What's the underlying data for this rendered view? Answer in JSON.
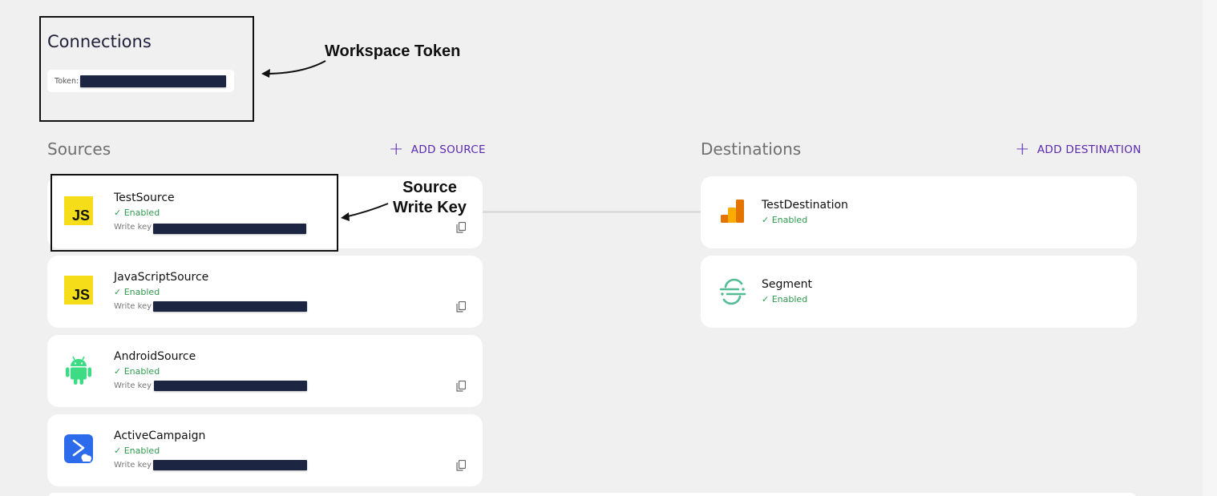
{
  "header": {
    "title": "Connections",
    "token_label": "Token:",
    "token_value": "(redacted)"
  },
  "annotations": {
    "workspace_token": "Workspace Token",
    "source_write_key_line1": "Source",
    "source_write_key_line2": "Write Key"
  },
  "sources": {
    "title": "Sources",
    "add_label": "ADD SOURCE",
    "items": [
      {
        "name": "TestSource",
        "status": "Enabled",
        "key_label": "Write key",
        "logo": "js-icon"
      },
      {
        "name": "JavaScriptSource",
        "status": "Enabled",
        "key_label": "Write key",
        "logo": "js-icon"
      },
      {
        "name": "AndroidSource",
        "status": "Enabled",
        "key_label": "Write key",
        "logo": "android-icon"
      },
      {
        "name": "ActiveCampaign",
        "status": "Enabled",
        "key_label": "Write key",
        "logo": "activecampaign-icon"
      }
    ]
  },
  "destinations": {
    "title": "Destinations",
    "add_label": "ADD DESTINATION",
    "items": [
      {
        "name": "TestDestination",
        "status": "Enabled",
        "logo": "google-analytics-icon"
      },
      {
        "name": "Segment",
        "status": "Enabled",
        "logo": "segment-icon"
      }
    ]
  },
  "js_logo_text": "JS",
  "status_check": "✓",
  "colors": {
    "background": "#f0f0f0",
    "accent": "#5b2ab0",
    "enabled": "#2f9a4e",
    "redaction": "#1c2541",
    "js_yellow": "#f5de19",
    "android_green": "#3ddc84",
    "ga_orange": "#f9ab00",
    "segment_green": "#52bd94"
  }
}
